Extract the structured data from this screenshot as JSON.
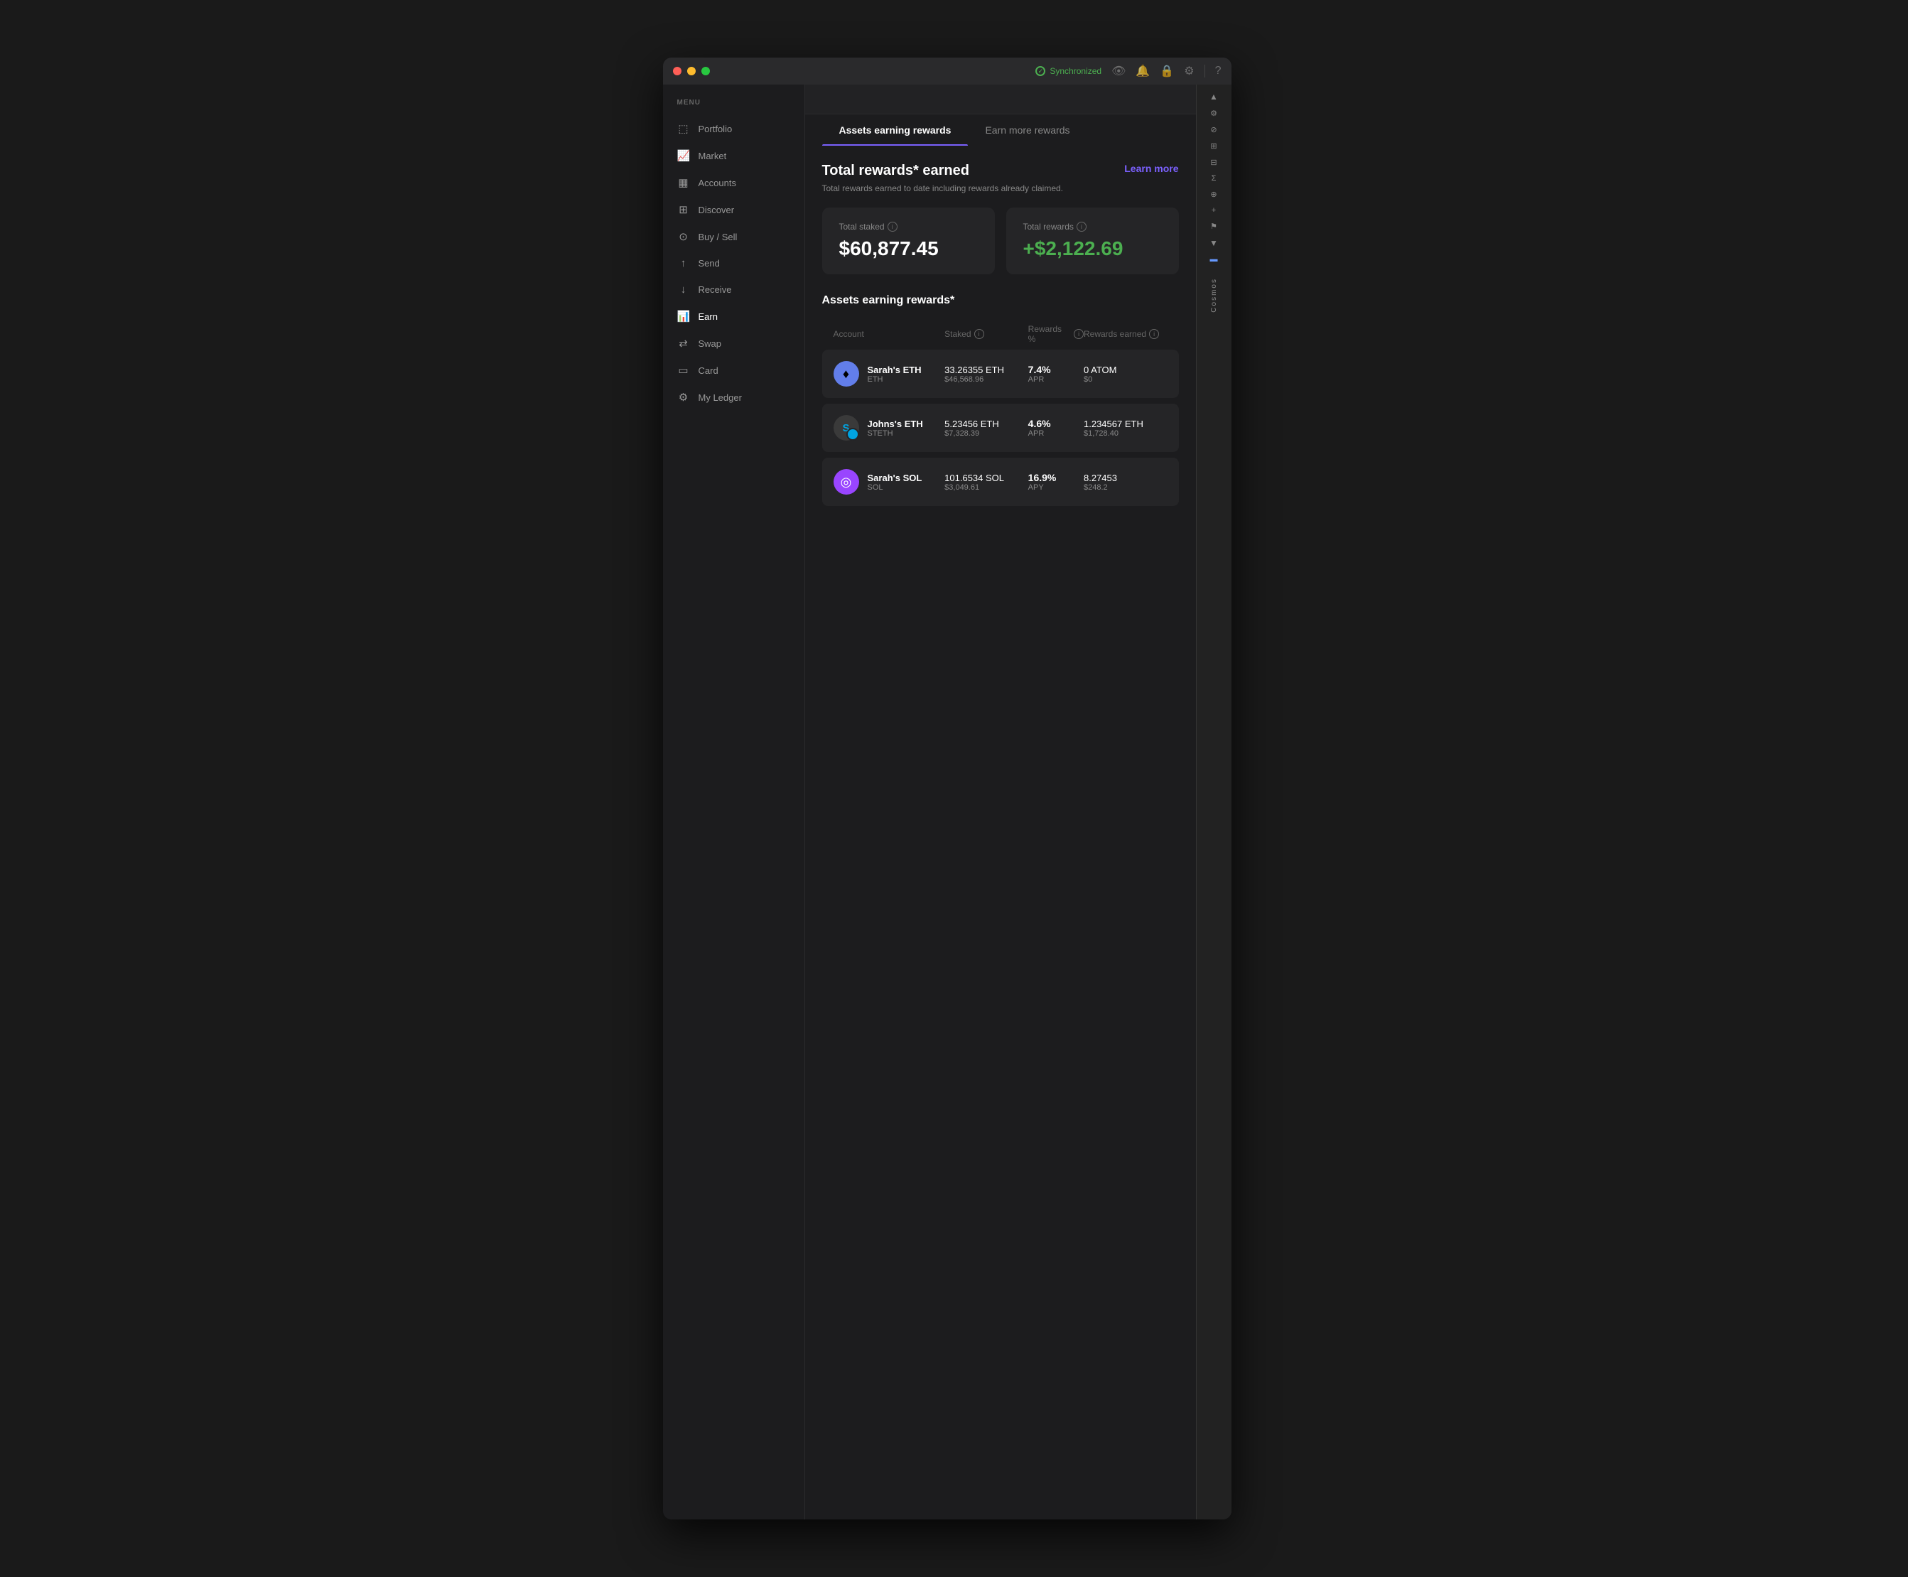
{
  "window": {
    "titlebar": {
      "sync_label": "Synchronized",
      "icons": [
        "eye",
        "bell",
        "lock",
        "gear",
        "divider",
        "question"
      ]
    }
  },
  "sidebar": {
    "menu_label": "MENU",
    "items": [
      {
        "id": "portfolio",
        "label": "Portfolio",
        "icon": "◱"
      },
      {
        "id": "market",
        "label": "Market",
        "icon": "📈"
      },
      {
        "id": "accounts",
        "label": "Accounts",
        "icon": "▦"
      },
      {
        "id": "discover",
        "label": "Discover",
        "icon": "⊞"
      },
      {
        "id": "buy-sell",
        "label": "Buy / Sell",
        "icon": "⊙"
      },
      {
        "id": "send",
        "label": "Send",
        "icon": "↑"
      },
      {
        "id": "receive",
        "label": "Receive",
        "icon": "↓"
      },
      {
        "id": "earn",
        "label": "Earn",
        "icon": "📊"
      },
      {
        "id": "swap",
        "label": "Swap",
        "icon": "⇄"
      },
      {
        "id": "card",
        "label": "Card",
        "icon": "▭"
      },
      {
        "id": "my-ledger",
        "label": "My Ledger",
        "icon": "⚙"
      }
    ]
  },
  "tabs": [
    {
      "id": "assets-earning",
      "label": "Assets earning rewards",
      "active": true
    },
    {
      "id": "earn-more",
      "label": "Earn more rewards",
      "active": false
    }
  ],
  "rewards_section": {
    "title": "Total rewards* earned",
    "subtitle": "Total rewards earned to date including rewards already claimed.",
    "learn_more": "Learn more",
    "total_staked_label": "Total staked",
    "total_staked_value": "$60,877.45",
    "total_rewards_label": "Total rewards",
    "total_rewards_value": "+$2,122.69"
  },
  "assets_table": {
    "title": "Assets earning rewards*",
    "headers": {
      "account": "Account",
      "staked": "Staked",
      "rewards_pct": "Rewards %",
      "rewards_earned": "Rewards earned"
    },
    "rows": [
      {
        "account_name": "Sarah's ETH",
        "ticker": "ETH",
        "avatar_type": "eth",
        "avatar_symbol": "⬡",
        "staked_amount": "33.26355 ETH",
        "staked_usd": "$46,568.96",
        "apy": "7.4%",
        "apy_type": "APR",
        "rewards": "0 ATOM",
        "rewards_usd": "$0"
      },
      {
        "account_name": "Johns's ETH",
        "ticker": "STETH",
        "avatar_type": "steth",
        "avatar_symbol": "S",
        "staked_amount": "5.23456 ETH",
        "staked_usd": "$7,328.39",
        "apy": "4.6%",
        "apy_type": "APR",
        "rewards": "1.234567 ETH",
        "rewards_usd": "$1,728.40"
      },
      {
        "account_name": "Sarah's SOL",
        "ticker": "SOL",
        "avatar_type": "sol",
        "avatar_symbol": "◎",
        "staked_amount": "101.6534 SOL",
        "staked_usd": "$3,049.61",
        "apy": "16.9%",
        "apy_type": "APY",
        "rewards": "8.27453",
        "rewards_usd": "$248.2"
      }
    ]
  }
}
